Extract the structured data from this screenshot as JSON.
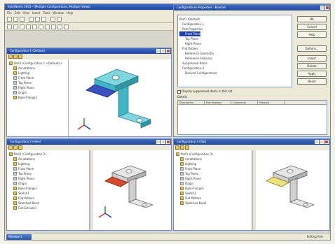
{
  "app": {
    "title": "SolidWorks 2003 - [Multiple Configurations, Multiple Views]",
    "menu": [
      "File",
      "Edit",
      "View",
      "Insert",
      "Tools",
      "Window",
      "Help"
    ]
  },
  "window_top_left": {
    "title": "Configuration 1 (Default)",
    "tree": [
      "Part1 (Configuration 1 <Default>)",
      "Annotations",
      "Lighting",
      "Front Plane",
      "Top Plane",
      "Right Plane",
      "Origin",
      "Base-Flange1"
    ]
  },
  "dialog": {
    "title": "Configurations Properties - Bracket",
    "list": [
      "Part1 (Default)",
      "Configuration 1",
      "Part Properties",
      "Front Plane",
      "Top Plane",
      "Right Plane",
      "Flat Pattern",
      "Reference Geometry",
      "Reference Features",
      "Suppressed Items",
      "Configuration-2",
      "Derived Configurations"
    ],
    "selected_index": 3,
    "checkbox_label": "Display suppressed items in this list",
    "buttons": [
      "OK",
      "Cancel",
      "Help",
      "Options...",
      "Insert",
      "Delete",
      "Apply",
      "Reset"
    ],
    "section_label": "Details",
    "grid_headers": [
      "Description",
      "Part Number",
      "Comments",
      "Material"
    ]
  },
  "window_bottom_left": {
    "title": "Configuration 2 (Hole)",
    "tree": [
      "Part1 (Configuration 2)",
      "Annotations",
      "Lighting",
      "Front Plane",
      "Top Plane",
      "Right Plane",
      "Origin",
      "Base-Flange1",
      "Sketch1",
      "Flat Pattern",
      "Sketched Bend",
      "Cut-Extrude1"
    ]
  },
  "window_bottom_right": {
    "title": "Configuration 3 (Tab)",
    "tree": [
      "Part1 (Configuration 3)",
      "Annotations",
      "Lighting",
      "Front Plane",
      "Top Plane",
      "Right Plane",
      "Origin",
      "Base-Flange1",
      "Sketch1",
      "Flat Pattern",
      "Sketched Bend"
    ]
  },
  "taskbar": {
    "label": "Window 1"
  },
  "status": {
    "text": "Editing Part"
  },
  "colors": {
    "titlebar": "#2a56ad",
    "part_teal": "#3fb6c6",
    "part_gray": "#cfcfcf",
    "highlight_red": "#d94a2a",
    "highlight_yellow": "#ece27a",
    "highlight_blue": "#3a4fc0"
  }
}
